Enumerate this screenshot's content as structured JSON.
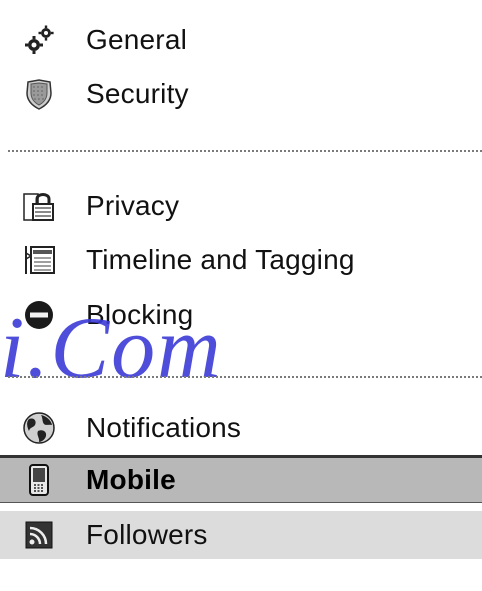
{
  "settings_menu": {
    "groups": [
      {
        "items": [
          {
            "label": "General",
            "icon": "gears-icon"
          },
          {
            "label": "Security",
            "icon": "shield-icon"
          }
        ]
      },
      {
        "items": [
          {
            "label": "Privacy",
            "icon": "lock-icon"
          },
          {
            "label": "Timeline and Tagging",
            "icon": "timeline-icon"
          },
          {
            "label": "Blocking",
            "icon": "blocking-icon"
          }
        ]
      },
      {
        "items": [
          {
            "label": "Notifications",
            "icon": "globe-icon"
          },
          {
            "label": "Mobile",
            "icon": "mobile-phone-icon",
            "state": "selected"
          },
          {
            "label": "Followers",
            "icon": "rss-icon",
            "state": "hover"
          }
        ]
      }
    ]
  },
  "watermark": {
    "text": "i.Com"
  }
}
